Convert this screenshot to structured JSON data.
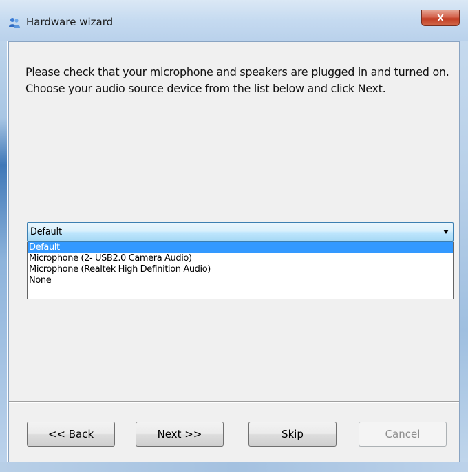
{
  "window": {
    "title": "Hardware wizard",
    "close_label": "X"
  },
  "content": {
    "instruction_line1": "Please check that your microphone and speakers are plugged in and turned on.",
    "instruction_line2": "Choose your audio source device from the list below and click Next."
  },
  "audio_source": {
    "selected": "Default",
    "options": [
      "Default",
      "Microphone (2- USB2.0 Camera Audio)",
      "Microphone (Realtek High Definition Audio)",
      "None"
    ],
    "highlight_color": "#3399ff"
  },
  "buttons": {
    "back": "<< Back",
    "next": "Next >>",
    "skip": "Skip",
    "cancel": "Cancel"
  },
  "icons": {
    "title_icon": "people-icon",
    "dropdown_icon": "chevron-down-icon"
  }
}
